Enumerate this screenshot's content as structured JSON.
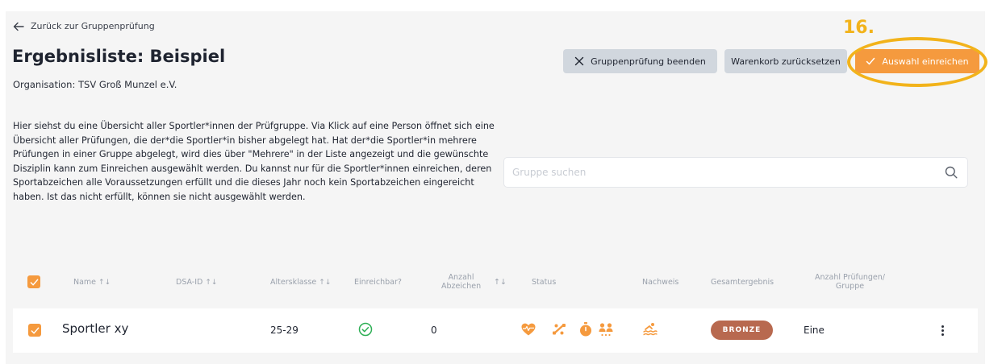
{
  "nav": {
    "back_label": "Zurück zur Gruppenprüfung"
  },
  "header": {
    "title": "Ergebnisliste: Beispiel",
    "organisation": "Organisation: TSV Groß Munzel e.V."
  },
  "actions": {
    "end_label": "Gruppenprüfung beenden",
    "reset_label": "Warenkorb zurücksetzen",
    "submit_label": "Auswahl einreichen"
  },
  "annotation": {
    "step": "16.",
    "highlight_color": "#f2b31b"
  },
  "description": "Hier siehst du eine Übersicht aller Sportler*innen der Prüfgruppe. Via Klick auf eine Person öffnet sich eine Übersicht aller Prüfungen, die der*die Sportler*in bisher abgelegt hat. Hat der*die Sportler*in mehrere Prüfungen in einer Gruppe abgelegt, wird dies über \"Mehrere\" in der Liste angezeigt und die gewünschte Disziplin kann zum Einreichen ausgewählt werden. Du kannst nur für die Sportler*innen einreichen, deren Sportabzeichen alle Voraussetzungen erfüllt und die dieses Jahr noch kein Sportabzeichen eingereicht haben. Ist das nicht erfüllt, können sie nicht ausgewählt werden.",
  "search": {
    "placeholder": "Gruppe suchen",
    "value": ""
  },
  "table": {
    "columns": {
      "name": "Name",
      "dsa_id": "DSA-ID",
      "altersklasse": "Altersklasse",
      "einreichbar": "Einreichbar?",
      "anzahl_line1": "Anzahl",
      "anzahl_line2": "Abzeichen",
      "status": "Status",
      "nachweis": "Nachweis",
      "gesamtergebnis": "Gesamtergebnis",
      "pruefungen_line1": "Anzahl Prüfungen/",
      "pruefungen_line2": "Gruppe"
    },
    "sort_glyph": "↑↓",
    "rows": [
      {
        "name": "Sportler xy",
        "dsa_id": "",
        "altersklasse": "25-29",
        "einreichbar": "check-circle-icon",
        "anzahl": "0",
        "status_icons": [
          "heart-pulse-icon",
          "strength-icon",
          "stopwatch-icon",
          "coordination-icon"
        ],
        "nachweis": "swimming-icon",
        "gesamtergebnis": "BRONZE",
        "pruefungen": "Eine",
        "selected": true
      }
    ]
  },
  "colors": {
    "accent": "#f59a3e",
    "bronze": "#b8694f",
    "success": "#2eaf55",
    "button_gray": "#d1d7de"
  }
}
